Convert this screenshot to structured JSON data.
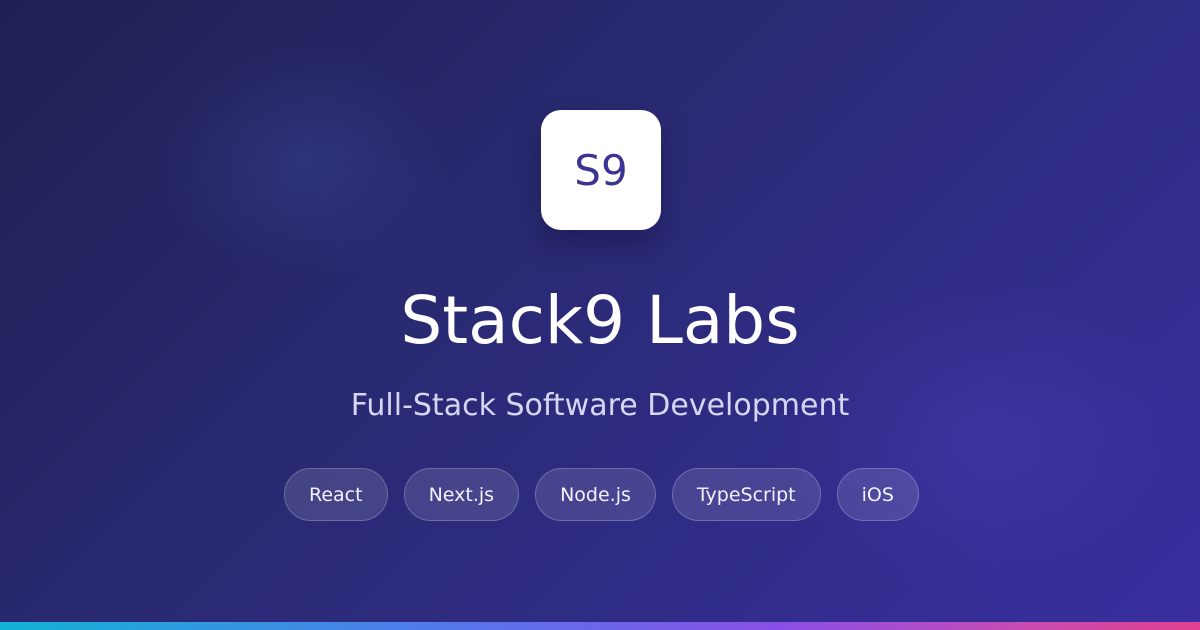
{
  "logo": {
    "text": "S9"
  },
  "title": "Stack9 Labs",
  "subtitle": "Full-Stack Software Development",
  "tags": [
    {
      "label": "React"
    },
    {
      "label": "Next.js"
    },
    {
      "label": "Node.js"
    },
    {
      "label": "TypeScript"
    },
    {
      "label": "iOS"
    }
  ],
  "colors": {
    "background_start": "#1f1f52",
    "background_end": "#3a2ea0",
    "logo_text": "#3b3490",
    "accent_bar": [
      "#13b3d6",
      "#4f7bea",
      "#8a4fe8",
      "#c64bb2",
      "#e0408f"
    ]
  }
}
